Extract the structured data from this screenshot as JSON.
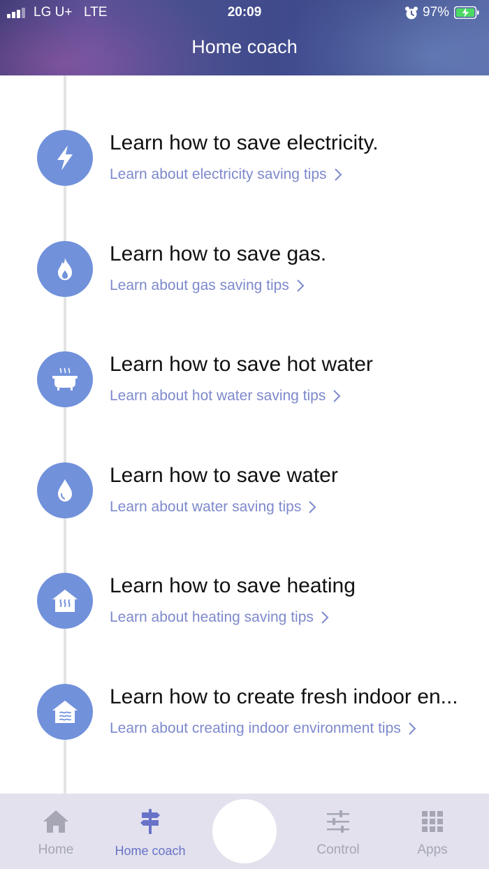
{
  "status_bar": {
    "carrier": "LG U+",
    "network": "LTE",
    "time": "20:09",
    "battery": "97%"
  },
  "header": {
    "title": "Home coach"
  },
  "tips": [
    {
      "icon": "lightning-icon",
      "title": "Learn how to save electricity.",
      "link": "Learn about electricity saving tips"
    },
    {
      "icon": "flame-icon",
      "title": "Learn how to save gas.",
      "link": "Learn about gas saving tips"
    },
    {
      "icon": "bathtub-icon",
      "title": "Learn how to save hot water",
      "link": "Learn about hot water saving tips"
    },
    {
      "icon": "water-drop-icon",
      "title": "Learn how to save water",
      "link": "Learn about water saving tips"
    },
    {
      "icon": "house-heating-icon",
      "title": "Learn how to save heating",
      "link": "Learn about heating saving tips"
    },
    {
      "icon": "house-air-icon",
      "title": "Learn how to create fresh indoor en...",
      "link": "Learn about creating indoor environment tips"
    }
  ],
  "bottom_nav": {
    "items": [
      {
        "label": "Home",
        "icon": "home-icon",
        "active": false
      },
      {
        "label": "Home coach",
        "icon": "signpost-icon",
        "active": true
      },
      {
        "label": "Control",
        "icon": "sliders-icon",
        "active": false
      },
      {
        "label": "Apps",
        "icon": "apps-grid-icon",
        "active": false
      }
    ]
  },
  "colors": {
    "accent": "#7191db",
    "link": "#7d89cc",
    "nav_active": "#6872c8",
    "nav_inactive": "#a6a6b4",
    "nav_bg": "#e2e1ed"
  }
}
